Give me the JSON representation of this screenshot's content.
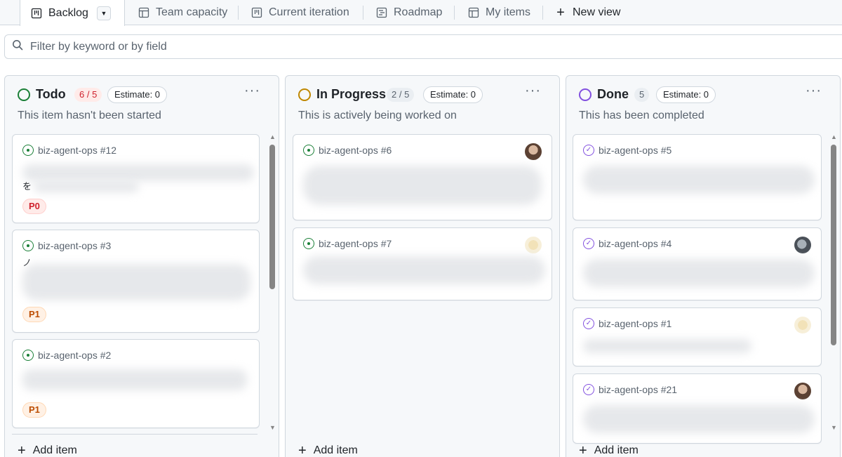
{
  "tabs": [
    {
      "label": "Backlog",
      "icon": "board-icon"
    },
    {
      "label": "Team capacity",
      "icon": "table-icon"
    },
    {
      "label": "Current iteration",
      "icon": "board-icon"
    },
    {
      "label": "Roadmap",
      "icon": "roadmap-icon"
    },
    {
      "label": "My items",
      "icon": "table-icon"
    }
  ],
  "new_view_label": "New view",
  "filter": {
    "placeholder": "Filter by keyword or by field"
  },
  "columns": [
    {
      "title": "Todo",
      "count": "6 / 5",
      "estimate": "Estimate: 0",
      "description": "This item hasn't been started",
      "status_color": "#1a7f37",
      "add_item": "Add item",
      "cards": [
        {
          "ref": "biz-agent-ops #12",
          "priority": "P0",
          "fragment": "を"
        },
        {
          "ref": "biz-agent-ops #3",
          "priority": "P1",
          "fragment": "ノ"
        },
        {
          "ref": "biz-agent-ops #2",
          "priority": "P1",
          "fragment": ""
        }
      ]
    },
    {
      "title": "In Progress",
      "count": "2 / 5",
      "estimate": "Estimate: 0",
      "description": "This is actively being worked on",
      "status_color": "#bf8700",
      "add_item": "Add item",
      "cards": [
        {
          "ref": "biz-agent-ops #6"
        },
        {
          "ref": "biz-agent-ops #7"
        }
      ]
    },
    {
      "title": "Done",
      "count": "5",
      "estimate": "Estimate: 0",
      "description": "This has been completed",
      "status_color": "#8250df",
      "add_item": "Add item",
      "cards": [
        {
          "ref": "biz-agent-ops #5"
        },
        {
          "ref": "biz-agent-ops #4"
        },
        {
          "ref": "biz-agent-ops #1"
        },
        {
          "ref": "biz-agent-ops #21"
        }
      ]
    }
  ]
}
